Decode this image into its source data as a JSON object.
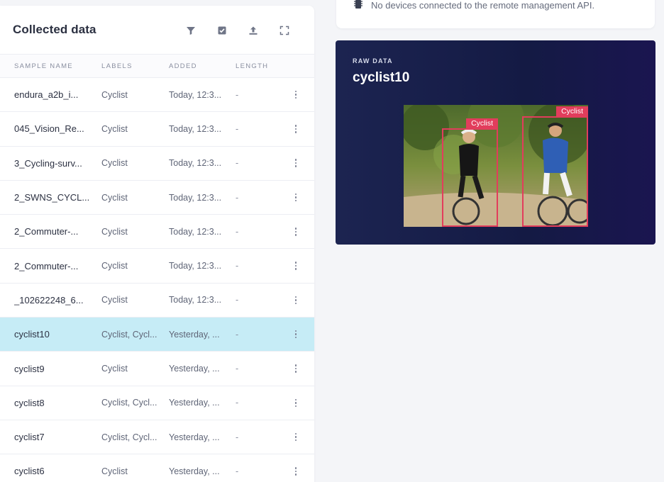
{
  "left_panel": {
    "title": "Collected data",
    "toolbar": [
      {
        "name": "filter-icon"
      },
      {
        "name": "select-icon"
      },
      {
        "name": "upload-icon"
      },
      {
        "name": "expand-icon"
      }
    ],
    "columns": {
      "name": "SAMPLE NAME",
      "labels": "LABELS",
      "added": "ADDED",
      "length": "LENGTH"
    },
    "rows": [
      {
        "name": "endura_a2b_i...",
        "labels": "Cyclist",
        "added": "Today, 12:3...",
        "length": "-"
      },
      {
        "name": "045_Vision_Re...",
        "labels": "Cyclist",
        "added": "Today, 12:3...",
        "length": "-"
      },
      {
        "name": "3_Cycling-surv...",
        "labels": "Cyclist",
        "added": "Today, 12:3...",
        "length": "-"
      },
      {
        "name": "2_SWNS_CYCL...",
        "labels": "Cyclist",
        "added": "Today, 12:3...",
        "length": "-"
      },
      {
        "name": "2_Commuter-...",
        "labels": "Cyclist",
        "added": "Today, 12:3...",
        "length": "-"
      },
      {
        "name": "2_Commuter-...",
        "labels": "Cyclist",
        "added": "Today, 12:3...",
        "length": "-"
      },
      {
        "name": "_102622248_6...",
        "labels": "Cyclist",
        "added": "Today, 12:3...",
        "length": "-"
      },
      {
        "name": "cyclist10",
        "labels": "Cyclist, Cycl...",
        "added": "Yesterday, ...",
        "length": "-"
      },
      {
        "name": "cyclist9",
        "labels": "Cyclist",
        "added": "Yesterday, ...",
        "length": "-"
      },
      {
        "name": "cyclist8",
        "labels": "Cyclist, Cycl...",
        "added": "Yesterday, ...",
        "length": "-"
      },
      {
        "name": "cyclist7",
        "labels": "Cyclist, Cycl...",
        "added": "Yesterday, ...",
        "length": "-"
      },
      {
        "name": "cyclist6",
        "labels": "Cyclist",
        "added": "Yesterday, ...",
        "length": "-"
      }
    ],
    "selected_index": 7
  },
  "devices": {
    "icon": "chip-icon",
    "message": "No devices connected to the remote management API."
  },
  "raw_data": {
    "kicker": "RAW DATA",
    "title": "cyclist10",
    "boxes": [
      {
        "label": "Cyclist"
      },
      {
        "label": "Cyclist"
      }
    ]
  },
  "colors": {
    "selected_row": "#c6ecf6",
    "raw_card_bg": "#161c48",
    "bbox": "#e23d5c"
  }
}
